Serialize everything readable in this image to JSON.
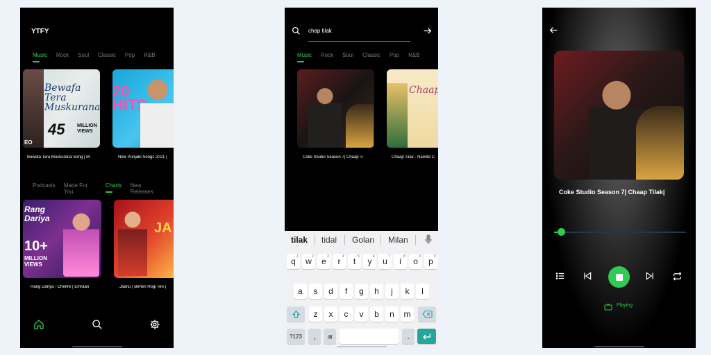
{
  "colors": {
    "accent": "#2ecc52",
    "background": "#000000",
    "teal": "#26a69a"
  },
  "screen1": {
    "app_title": "YTFY",
    "genre_tabs": [
      "Music",
      "Rock",
      "Soul",
      "Classic",
      "Pop",
      "R&B"
    ],
    "top_cards": [
      {
        "caption": "Bewafa Tera Muskurana Song | M",
        "art_title": "Bewafa Tera Muskurana",
        "art_badge": "45",
        "art_badge_sub": "MILLION VIEWS",
        "art_corner": "EO"
      },
      {
        "caption": "New Punjabi Songs 2021 |",
        "art_title": "20 HITS"
      }
    ],
    "section_tabs": [
      "Podcasts",
      "Made For You",
      "Charts",
      "New Releases"
    ],
    "bottom_cards": [
      {
        "caption": "Rang Dariya - Chehre | Emraan",
        "art_title": "Rang Dariya",
        "art_badge": "10+",
        "art_badge_sub": "MILLION VIEWS"
      },
      {
        "caption": "Jaanu | Behen Hogi Teri |",
        "art_title": "JA"
      }
    ],
    "nav": [
      "home-icon",
      "search-icon",
      "settings-icon"
    ]
  },
  "screen2": {
    "search_value": "chap tilak",
    "genre_tabs": [
      "Music",
      "Rock",
      "Soul",
      "Classic",
      "Pop",
      "R&B"
    ],
    "cards": [
      {
        "caption": "Coke Studio Season 7| Chaap Ti"
      },
      {
        "caption": "Chaap Tilak - Namita C",
        "art_title": "Chaap"
      }
    ],
    "suggestions": [
      "tilak",
      "tidal",
      "Golan",
      "Milan"
    ],
    "keyboard": {
      "row1": [
        {
          "k": "q",
          "s": "1"
        },
        {
          "k": "w",
          "s": "2"
        },
        {
          "k": "e",
          "s": "3"
        },
        {
          "k": "r",
          "s": "4"
        },
        {
          "k": "t",
          "s": "5"
        },
        {
          "k": "y",
          "s": "6"
        },
        {
          "k": "u",
          "s": "7"
        },
        {
          "k": "i",
          "s": "8"
        },
        {
          "k": "o",
          "s": "9"
        },
        {
          "k": "p",
          "s": "0"
        }
      ],
      "row2": [
        "a",
        "s",
        "d",
        "f",
        "g",
        "h",
        "j",
        "k",
        "l"
      ],
      "row3": [
        "z",
        "x",
        "c",
        "v",
        "b",
        "n",
        "m"
      ],
      "sym": "?123",
      "comma": ",",
      "lang": "अ",
      "period": "."
    }
  },
  "screen3": {
    "track_title": "Coke Studio Season 7| Chaap Tilak|",
    "progress": 0.03,
    "status": "Playing"
  }
}
